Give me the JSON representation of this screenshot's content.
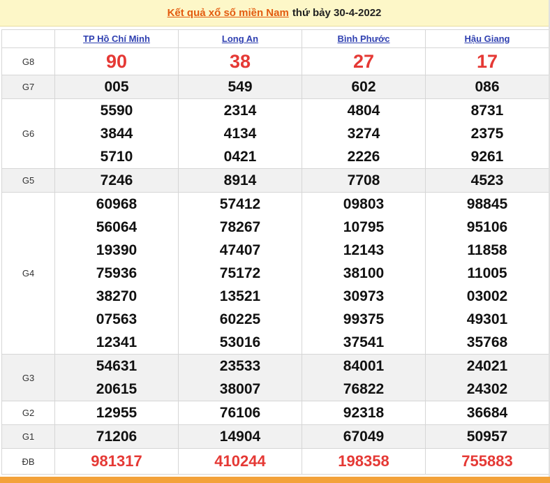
{
  "header": {
    "link_text": "Kết quả xổ số miền Nam",
    "rest_text": "thứ bảy 30-4-2022"
  },
  "provinces": [
    "TP Hồ Chí Minh",
    "Long An",
    "Bình Phước",
    "Hậu Giang"
  ],
  "prizes": [
    {
      "label": "G8",
      "values": [
        [
          "90"
        ],
        [
          "38"
        ],
        [
          "27"
        ],
        [
          "17"
        ]
      ]
    },
    {
      "label": "G7",
      "values": [
        [
          "005"
        ],
        [
          "549"
        ],
        [
          "602"
        ],
        [
          "086"
        ]
      ]
    },
    {
      "label": "G6",
      "values": [
        [
          "5590",
          "3844",
          "5710"
        ],
        [
          "2314",
          "4134",
          "0421"
        ],
        [
          "4804",
          "3274",
          "2226"
        ],
        [
          "8731",
          "2375",
          "9261"
        ]
      ]
    },
    {
      "label": "G5",
      "values": [
        [
          "7246"
        ],
        [
          "8914"
        ],
        [
          "7708"
        ],
        [
          "4523"
        ]
      ]
    },
    {
      "label": "G4",
      "values": [
        [
          "60968",
          "56064",
          "19390",
          "75936",
          "38270",
          "07563",
          "12341"
        ],
        [
          "57412",
          "78267",
          "47407",
          "75172",
          "13521",
          "60225",
          "53016"
        ],
        [
          "09803",
          "10795",
          "12143",
          "38100",
          "30973",
          "99375",
          "37541"
        ],
        [
          "98845",
          "95106",
          "11858",
          "11005",
          "03002",
          "49301",
          "35768"
        ]
      ]
    },
    {
      "label": "G3",
      "values": [
        [
          "54631",
          "20615"
        ],
        [
          "23533",
          "38007"
        ],
        [
          "84001",
          "76822"
        ],
        [
          "24021",
          "24302"
        ]
      ]
    },
    {
      "label": "G2",
      "values": [
        [
          "12955"
        ],
        [
          "76106"
        ],
        [
          "92318"
        ],
        [
          "36684"
        ]
      ]
    },
    {
      "label": "G1",
      "values": [
        [
          "71206"
        ],
        [
          "14904"
        ],
        [
          "67049"
        ],
        [
          "50957"
        ]
      ]
    },
    {
      "label": "ĐB",
      "values": [
        [
          "981317"
        ],
        [
          "410244"
        ],
        [
          "198358"
        ],
        [
          "755883"
        ]
      ]
    }
  ],
  "colors": {
    "accent": "#e53935",
    "link": "#2e3fb0",
    "header_bg": "#fdf7c8",
    "footer_bar": "#f3a23a"
  }
}
